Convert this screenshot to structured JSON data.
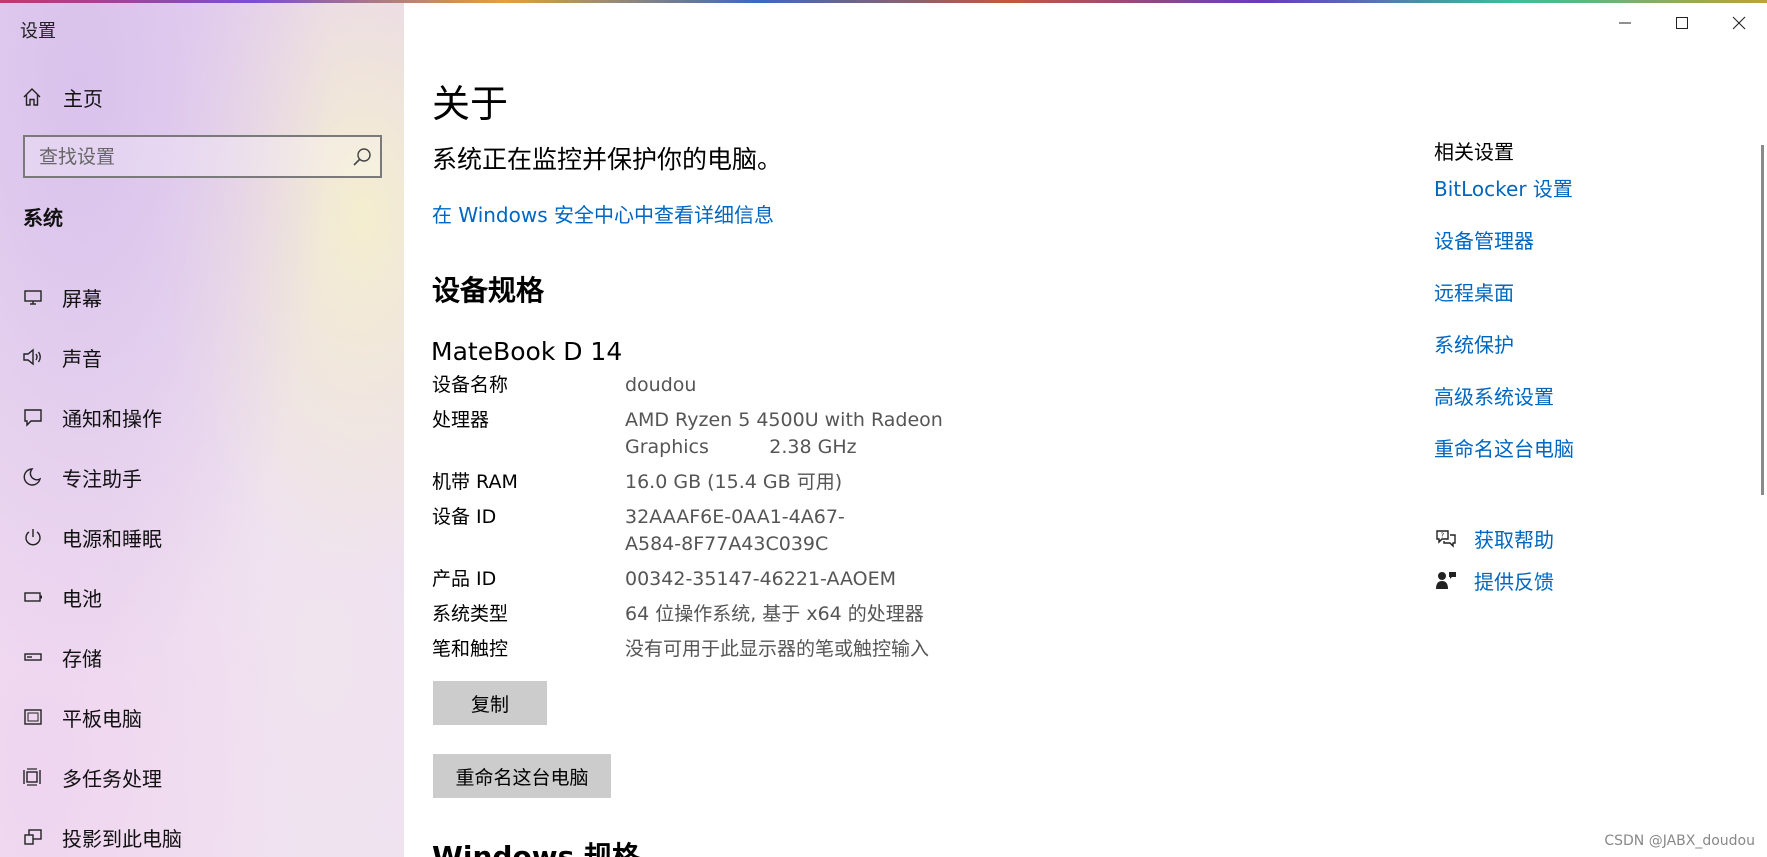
{
  "window": {
    "title": "设置",
    "controls": [
      "minimize",
      "maximize",
      "close"
    ]
  },
  "sidebar": {
    "home_label": "主页",
    "search_placeholder": "查找设置",
    "section_label": "系统",
    "items": [
      {
        "label": "屏幕",
        "icon": "display-icon"
      },
      {
        "label": "声音",
        "icon": "speaker-icon"
      },
      {
        "label": "通知和操作",
        "icon": "notification-icon"
      },
      {
        "label": "专注助手",
        "icon": "moon-icon"
      },
      {
        "label": "电源和睡眠",
        "icon": "power-icon"
      },
      {
        "label": "电池",
        "icon": "battery-icon"
      },
      {
        "label": "存储",
        "icon": "storage-icon"
      },
      {
        "label": "平板电脑",
        "icon": "tablet-icon"
      },
      {
        "label": "多任务处理",
        "icon": "multitask-icon"
      },
      {
        "label": "投影到此电脑",
        "icon": "project-icon"
      }
    ]
  },
  "main": {
    "page_title": "关于",
    "status_text": "系统正在监控并保护你的电脑。",
    "security_link": "在 Windows 安全中心中查看详细信息",
    "specs_heading": "设备规格",
    "device_model": "MateBook D 14",
    "specs": [
      {
        "key": "设备名称",
        "value": "doudou"
      },
      {
        "key": "处理器",
        "value": "AMD Ryzen 5 4500U with Radeon Graphics 2.38 GHz",
        "line1": "AMD Ryzen 5 4500U with Radeon",
        "line2": "Graphics          2.38 GHz"
      },
      {
        "key": "机带 RAM",
        "value": "16.0 GB (15.4 GB 可用)"
      },
      {
        "key": "设备 ID",
        "value": "32AAAF6E-0AA1-4A67-A584-8F77A43C039C",
        "line1": "32AAAF6E-0AA1-4A67-",
        "line2": "A584-8F77A43C039C"
      },
      {
        "key": "产品 ID",
        "value": "00342-35147-46221-AAOEM"
      },
      {
        "key": "系统类型",
        "value": "64 位操作系统, 基于 x64 的处理器"
      },
      {
        "key": "笔和触控",
        "value": "没有可用于此显示器的笔或触控输入"
      }
    ],
    "copy_button": "复制",
    "rename_button": "重命名这台电脑",
    "windows_specs_heading": "Windows 规格"
  },
  "related": {
    "title": "相关设置",
    "links": [
      "BitLocker 设置",
      "设备管理器",
      "远程桌面",
      "系统保护",
      "高级系统设置",
      "重命名这台电脑"
    ],
    "help": [
      {
        "label": "获取帮助",
        "icon": "help-chat-icon"
      },
      {
        "label": "提供反馈",
        "icon": "feedback-icon"
      }
    ]
  },
  "watermark": "CSDN @JABX_doudou",
  "colors": {
    "link": "#0066c0",
    "button_bg": "#cccccc",
    "sidebar_tint": "#e7d3ef"
  }
}
